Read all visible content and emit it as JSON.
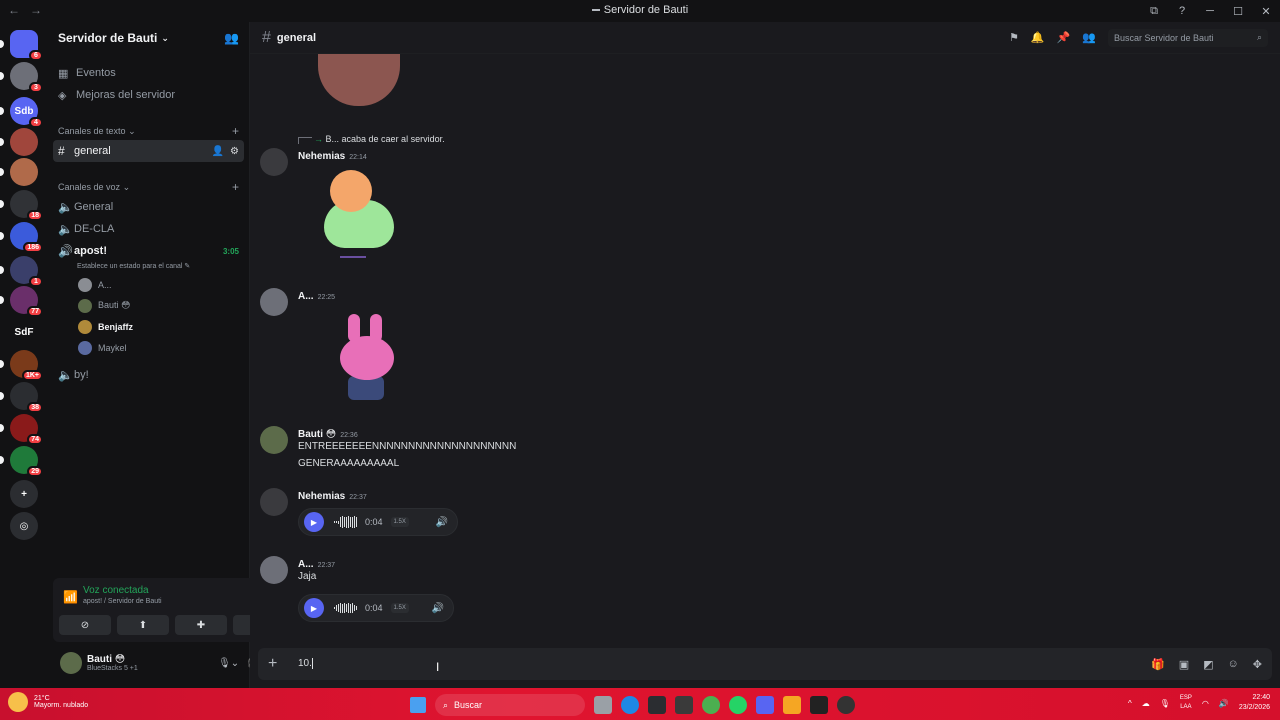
{
  "window": {
    "title": "Servidor de Bauti",
    "nav_back": "←",
    "nav_forward": "→"
  },
  "titlebar_buttons": [
    "⧉",
    "?",
    "─",
    "☐",
    "✕"
  ],
  "servers": [
    {
      "label": "",
      "badge": "6",
      "color": "#5865f2",
      "icon": "discord-icon"
    },
    {
      "label": "",
      "badge": "3",
      "color": "#6d6f78"
    },
    {
      "label": "Sdb",
      "badge": "4",
      "color": "#5865f2"
    },
    {
      "label": "",
      "badge": "",
      "color": "#a0463c"
    },
    {
      "label": "",
      "badge": "",
      "color": "#b06a4a"
    },
    {
      "label": "",
      "badge": "18",
      "color": "#303236"
    },
    {
      "label": "",
      "badge": "186",
      "color": "#3b5bdb"
    },
    {
      "label": "",
      "badge": "1",
      "color": "#3a3f6a"
    },
    {
      "label": "",
      "badge": "77",
      "color": "#6a2f6a"
    },
    {
      "label": "SdF",
      "badge": "",
      "color": "#121214"
    },
    {
      "label": "",
      "badge": "1K+",
      "color": "#7a3a1a"
    },
    {
      "label": "",
      "badge": "38",
      "color": "#2b2d31"
    },
    {
      "label": "",
      "badge": "74",
      "color": "#8a1a1a"
    },
    {
      "label": "",
      "badge": "29",
      "color": "#1f7a3a"
    },
    {
      "label": "+",
      "badge": "",
      "color": "#2b2d31",
      "icon": "add-server-icon"
    },
    {
      "label": "◎",
      "badge": "",
      "color": "#2b2d31",
      "icon": "explore-icon"
    }
  ],
  "sidebar": {
    "server_name": "Servidor de Bauti",
    "chevron": "⌄",
    "invite_icon": "👥",
    "events": "Eventos",
    "boosts": "Mejoras del servidor",
    "text_category": "Canales de texto",
    "voice_category": "Canales de voz",
    "text_channels": [
      {
        "name": "general"
      }
    ],
    "voice_channels": [
      {
        "name": "General"
      },
      {
        "name": "DE-CLA"
      }
    ],
    "active_voice": {
      "name": "apost!",
      "time": "3:05",
      "status": "Establece un estado para el canal",
      "users": [
        {
          "name": "A...",
          "avatar_color": "#8a8d93"
        },
        {
          "name": "Bauti 😳",
          "avatar_color": "#5c6b4a"
        },
        {
          "name": "Benjaffz",
          "avatar_color": "#b08a3a"
        },
        {
          "name": "Maykel",
          "avatar_color": "#5a6aa0"
        }
      ]
    },
    "last_voice": "by!"
  },
  "voice_panel": {
    "status": "Voz conectada",
    "channel": "apost! / Servidor de Bauti"
  },
  "user": {
    "name": "Bauti 😳",
    "status": "BlueStacks 5 +1"
  },
  "header": {
    "channel": "general",
    "search_placeholder": "Buscar Servidor de Bauti"
  },
  "messages": {
    "system": "B... acaba de caer al servidor.",
    "m1": {
      "author": "Nehemias",
      "time": "22:14"
    },
    "m2": {
      "author": "A...",
      "time": "22:25"
    },
    "m3": {
      "author": "Bauti 😳",
      "time": "22:36",
      "line1": "ENTREEEEEEENNNNNNNNNNNNNNNNNNNN",
      "line2": "GENERAAAAAAAAAL"
    },
    "m4": {
      "author": "Nehemias",
      "time": "22:37",
      "audio": {
        "duration": "0:04",
        "speed": "1.5X"
      }
    },
    "m5": {
      "author": "A...",
      "time": "22:37",
      "text": "Jaja",
      "audio": {
        "duration": "0:04",
        "speed": "1.5X"
      }
    }
  },
  "composer": {
    "value": "10."
  },
  "taskbar": {
    "temp": "21°C",
    "condition": "Mayorm. nublado",
    "search": "Buscar",
    "lang1": "ESP",
    "lang2": "LAA",
    "time": "22:40",
    "date": "23/2/2026"
  }
}
